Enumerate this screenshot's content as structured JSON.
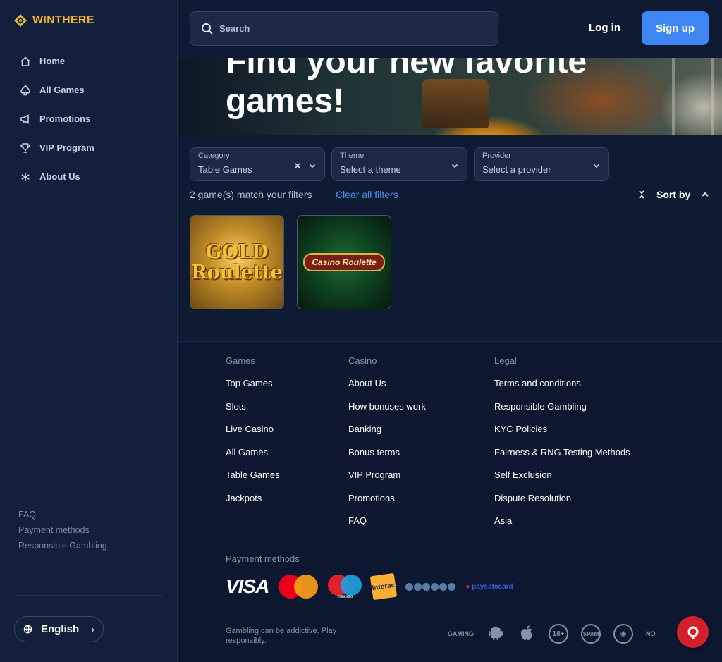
{
  "brand": {
    "name": "WINTHERE",
    "color": "#f0b429"
  },
  "sidebar": {
    "nav": [
      {
        "label": "Home",
        "icon": "home-icon"
      },
      {
        "label": "All Games",
        "icon": "spade-icon"
      },
      {
        "label": "Promotions",
        "icon": "megaphone-icon"
      },
      {
        "label": "VIP Program",
        "icon": "trophy-icon"
      },
      {
        "label": "About Us",
        "icon": "asterisk-icon"
      }
    ],
    "links": [
      "FAQ",
      "Payment methods",
      "Responsible Gambling"
    ],
    "language": "English"
  },
  "header": {
    "search_placeholder": "Search",
    "login": "Log in",
    "signup": "Sign up",
    "accent": "#3d86f4"
  },
  "banner": {
    "title": "Find your new favorite\ngames!"
  },
  "filters": [
    {
      "label": "Category",
      "value": "Table Games",
      "clearable": true
    },
    {
      "label": "Theme",
      "value": "Select a theme"
    },
    {
      "label": "Provider",
      "value": "Select a provider"
    }
  ],
  "results": {
    "match_text": "2 game(s) match your filters",
    "clear_text": "Clear all filters",
    "sort_label": "Sort by"
  },
  "games": [
    {
      "title": "GOLD\nRoulette"
    },
    {
      "title": "Casino Roulette"
    }
  ],
  "footer": {
    "columns": [
      {
        "heading": "Games",
        "links": [
          "Top Games",
          "Slots",
          "Live Casino",
          "All Games",
          "Table Games",
          "Jackpots"
        ]
      },
      {
        "heading": "Casino",
        "links": [
          "About Us",
          "How bonuses work",
          "Banking",
          "Bonus terms",
          "VIP Program",
          "Promotions",
          "FAQ"
        ]
      },
      {
        "heading": "Legal",
        "links": [
          "Terms and conditions",
          "Responsible Gambling",
          "KYC Policies",
          "Fairness & RNG Testing Methods",
          "Self Exclusion",
          "Dispute Resolution",
          "Asia"
        ]
      }
    ],
    "payment_title": "Payment methods",
    "payments": {
      "visa": "VISA",
      "maestro": "maestro",
      "interac": "Interac",
      "paysafe": "paysafecard"
    },
    "disclaimer": "Gambling can be addictive. Play\nresponsibly.",
    "badges": {
      "gaming": "GAMING",
      "age": "18+",
      "spam": "SPAM",
      "no": "NO"
    }
  }
}
